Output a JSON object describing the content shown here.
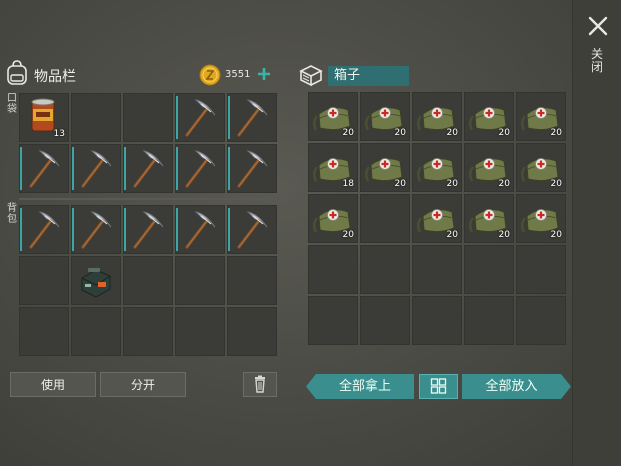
{
  "sidebar": {
    "close_label": "关闭"
  },
  "inventory": {
    "title": "物品栏",
    "currency": "3551",
    "pocket_label": "口袋",
    "backpack_label": "背包",
    "pocket_slots": [
      {
        "item": "canned-food",
        "qty": "13"
      },
      {
        "item": "",
        "qty": ""
      },
      {
        "item": "",
        "qty": ""
      },
      {
        "item": "pickaxe",
        "qty": "",
        "durability": 0.5
      },
      {
        "item": "pickaxe",
        "qty": "",
        "durability": 1
      },
      {
        "item": "pickaxe",
        "qty": "",
        "durability": 1
      },
      {
        "item": "pickaxe",
        "qty": "",
        "durability": 1
      },
      {
        "item": "pickaxe",
        "qty": "",
        "durability": 1
      },
      {
        "item": "pickaxe",
        "qty": "",
        "durability": 1
      },
      {
        "item": "pickaxe",
        "qty": "",
        "durability": 1
      }
    ],
    "backpack_slots": [
      {
        "item": "pickaxe",
        "qty": "",
        "durability": 1
      },
      {
        "item": "pickaxe",
        "qty": "",
        "durability": 1
      },
      {
        "item": "pickaxe",
        "qty": "",
        "durability": 1
      },
      {
        "item": "pickaxe",
        "qty": "",
        "durability": 1
      },
      {
        "item": "pickaxe",
        "qty": "",
        "durability": 1
      },
      {
        "item": "",
        "qty": ""
      },
      {
        "item": "toolbox",
        "qty": ""
      },
      {
        "item": "",
        "qty": ""
      },
      {
        "item": "",
        "qty": ""
      },
      {
        "item": "",
        "qty": ""
      },
      {
        "item": "",
        "qty": ""
      },
      {
        "item": "",
        "qty": ""
      },
      {
        "item": "",
        "qty": ""
      },
      {
        "item": "",
        "qty": ""
      },
      {
        "item": "",
        "qty": ""
      }
    ],
    "use_label": "使用",
    "split_label": "分开"
  },
  "chest": {
    "title": "箱子",
    "slots": [
      {
        "item": "medkit-bag",
        "qty": "20"
      },
      {
        "item": "medkit-bag",
        "qty": "20"
      },
      {
        "item": "medkit-bag",
        "qty": "20"
      },
      {
        "item": "medkit-bag",
        "qty": "20"
      },
      {
        "item": "medkit-bag",
        "qty": "20"
      },
      {
        "item": "medkit-bag",
        "qty": "18"
      },
      {
        "item": "medkit-bag",
        "qty": "20"
      },
      {
        "item": "medkit-bag",
        "qty": "20"
      },
      {
        "item": "medkit-bag",
        "qty": "20"
      },
      {
        "item": "medkit-bag",
        "qty": "20"
      },
      {
        "item": "medkit-bag",
        "qty": "20"
      },
      {
        "item": "",
        "qty": ""
      },
      {
        "item": "medkit-bag",
        "qty": "20"
      },
      {
        "item": "medkit-bag",
        "qty": "20"
      },
      {
        "item": "medkit-bag",
        "qty": "20"
      },
      {
        "item": "",
        "qty": ""
      },
      {
        "item": "",
        "qty": ""
      },
      {
        "item": "",
        "qty": ""
      },
      {
        "item": "",
        "qty": ""
      },
      {
        "item": "",
        "qty": ""
      },
      {
        "item": "",
        "qty": ""
      },
      {
        "item": "",
        "qty": ""
      },
      {
        "item": "",
        "qty": ""
      },
      {
        "item": "",
        "qty": ""
      },
      {
        "item": "",
        "qty": ""
      }
    ],
    "take_all_label": "全部拿上",
    "put_all_label": "全部放入"
  },
  "colors": {
    "accent_teal": "#3a8f8e",
    "slot_bg": "#3b3b37",
    "coin_gold": "#e0a81f"
  }
}
